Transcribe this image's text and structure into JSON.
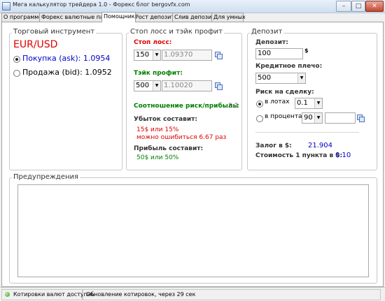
{
  "window": {
    "title": "Мега калькулятор трейдера 1.0 - Форекс блог bergovfx.com",
    "controls": {
      "minimize": "–",
      "maximize": "□",
      "close": "✕"
    }
  },
  "tabs": [
    {
      "label": "О программе",
      "active": false
    },
    {
      "label": "Форекс валютные пары",
      "active": false
    },
    {
      "label": "Помощник",
      "active": true
    },
    {
      "label": "Рост депозита",
      "active": false
    },
    {
      "label": "Слив депозита",
      "active": false
    },
    {
      "label": "Для умных",
      "active": false
    }
  ],
  "instrument": {
    "legend": "Торговый инструмент",
    "pair": "EUR/USD",
    "buy_label": "Покупка (ask): 1.0954",
    "sell_label": "Продажа (bid): 1.0952",
    "selected": "buy"
  },
  "stops": {
    "legend": "Стоп лосс и тэйк профит",
    "stop_loss_label": "Стоп лосс:",
    "stop_loss_points": "150",
    "stop_loss_price": "1.09370",
    "take_profit_label": "Тэйк профит:",
    "take_profit_points": "500",
    "take_profit_price": "1.10020",
    "ratio_label": "Соотношение риск/прибыль:",
    "ratio_value": "3.3",
    "loss_label": "Убыток составит:",
    "loss_line1": "15$ или 15%",
    "loss_line2": "можно ошибиться 6.67 раз",
    "profit_label": "Прибыль составит:",
    "profit_line": "50$ или 50%"
  },
  "deposit": {
    "legend": "Депозит",
    "deposit_label": "Депозит:",
    "deposit_value": "100",
    "currency": "$",
    "leverage_label": "Кредитное плечо:",
    "leverage_value": "500",
    "risk_label": "Риск на сделку:",
    "risk_lots_label": "в лотах",
    "risk_lots_value": "0.1",
    "risk_percent_label": "в процентах",
    "risk_percent_value": "90",
    "risk_percent_extra": "",
    "risk_selected": "lots",
    "margin_label": "Залог в $:",
    "margin_value": "21.904",
    "pip_cost_label": "Стоимость 1 пункта в $:",
    "pip_cost_value": "0.10"
  },
  "warnings": {
    "legend": "Предупреждения",
    "text": ""
  },
  "status": {
    "quotes": "Котировки валют доступны",
    "update": "Обновление котировок, через 29 сек"
  }
}
